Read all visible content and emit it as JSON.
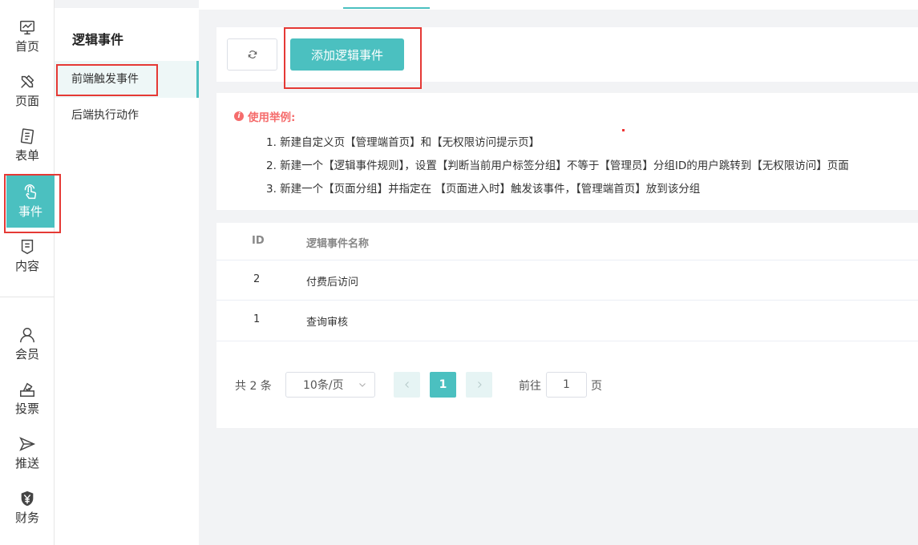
{
  "rail": {
    "items": [
      {
        "label": "首页",
        "icon": "monitor-icon"
      },
      {
        "label": "页面",
        "icon": "tools-icon"
      },
      {
        "label": "表单",
        "icon": "form-icon"
      },
      {
        "label": "事件",
        "icon": "tap-icon"
      },
      {
        "label": "内容",
        "icon": "content-icon"
      },
      {
        "label": "会员",
        "icon": "user-icon"
      },
      {
        "label": "投票",
        "icon": "vote-icon"
      },
      {
        "label": "推送",
        "icon": "send-icon"
      },
      {
        "label": "财务",
        "icon": "yen-icon"
      }
    ],
    "active": "事件"
  },
  "submenu": {
    "title": "逻辑事件",
    "items": [
      {
        "label": "前端触发事件"
      },
      {
        "label": "后端执行动作"
      }
    ]
  },
  "toolbar": {
    "add_label": "添加逻辑事件"
  },
  "info": {
    "heading": "使用举例:",
    "lines": [
      "1. 新建自定义页【管理端首页】和【无权限访问提示页】",
      "2. 新建一个【逻辑事件规则】，设置【判断当前用户标签分组】不等于【管理员】分组ID的用户跳转到【无权限访问】页面",
      "3. 新建一个【页面分组】并指定在 【页面进入时】触发该事件，【管理端首页】放到该分组"
    ]
  },
  "table": {
    "columns": [
      "ID",
      "逻辑事件名称"
    ],
    "rows": [
      {
        "id": "2",
        "name": "付费后访问"
      },
      {
        "id": "1",
        "name": "查询审核"
      }
    ]
  },
  "pager": {
    "total": "共 2 条",
    "page_size": "10条/页",
    "current": "1",
    "goto_label": "前往",
    "goto_value": "1",
    "page_suffix": "页"
  },
  "colors": {
    "accent": "#4bc0c0",
    "highlight": "#e53935",
    "warning": "#f56c6c"
  }
}
